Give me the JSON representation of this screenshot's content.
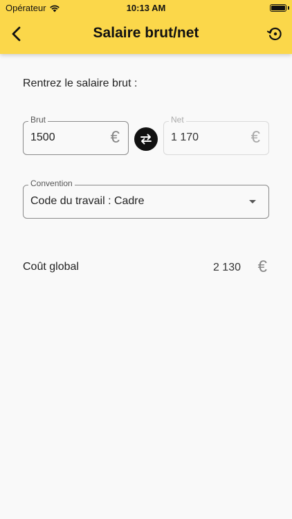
{
  "status_bar": {
    "carrier": "Opérateur",
    "time": "10:13 AM"
  },
  "nav": {
    "title": "Salaire brut/net",
    "back_icon": "chevron-left-icon",
    "history_icon": "history-icon"
  },
  "form": {
    "prompt": "Rentrez le salaire brut :",
    "brut": {
      "label": "Brut",
      "value": "1500",
      "currency": "€"
    },
    "net": {
      "label": "Net",
      "value": "1 170",
      "currency": "€"
    },
    "swap_icon": "swap-icon",
    "convention": {
      "label": "Convention",
      "value": "Code du travail : Cadre"
    }
  },
  "summary": {
    "label": "Coût global",
    "value": "2 130",
    "currency": "€"
  },
  "colors": {
    "header": "#fbd74a",
    "background": "#f9f9f9",
    "accent": "#111111"
  }
}
